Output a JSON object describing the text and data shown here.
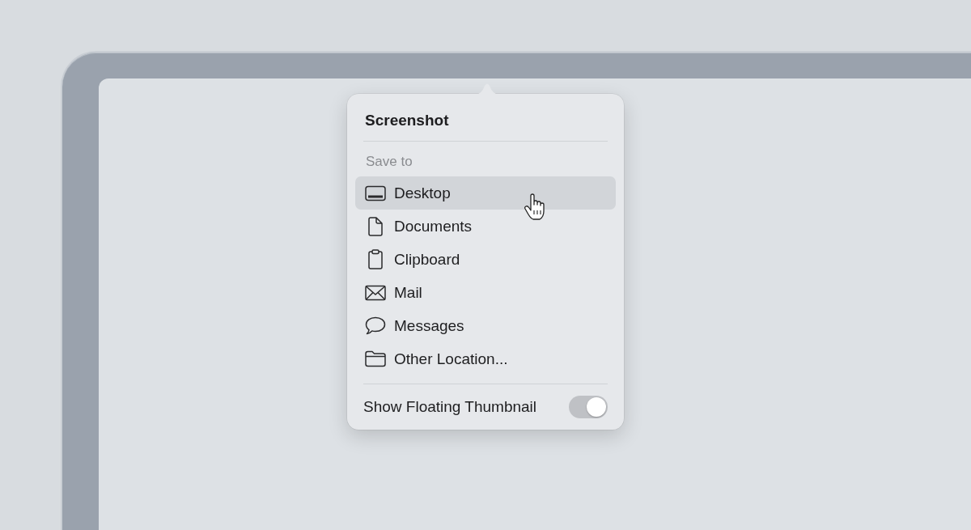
{
  "popover": {
    "title": "Screenshot",
    "section_label": "Save to",
    "items": [
      {
        "label": "Desktop",
        "kind": "desktop",
        "selected": true
      },
      {
        "label": "Documents",
        "kind": "document",
        "selected": false
      },
      {
        "label": "Clipboard",
        "kind": "clipboard",
        "selected": false
      },
      {
        "label": "Mail",
        "kind": "mail",
        "selected": false
      },
      {
        "label": "Messages",
        "kind": "message",
        "selected": false
      },
      {
        "label": "Other Location...",
        "kind": "folder",
        "selected": false
      }
    ],
    "toggle": {
      "label": "Show Floating Thumbnail",
      "on": true
    }
  }
}
